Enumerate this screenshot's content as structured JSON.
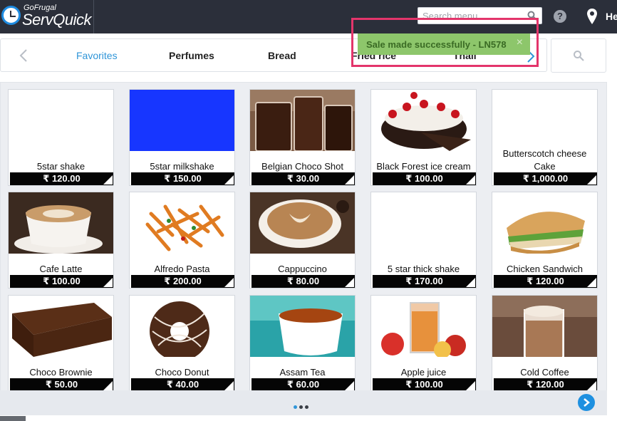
{
  "app": {
    "brand_small": "GoFrugal",
    "brand_big": "ServQuick",
    "search_placeholder": "Search menu",
    "user_text": "He"
  },
  "toast": {
    "message": "Sale made successfully - LN578",
    "close": "×"
  },
  "tabs": [
    {
      "label": "Favorites",
      "active": true
    },
    {
      "label": "Perfumes"
    },
    {
      "label": "Bread"
    },
    {
      "label": "Fried rice"
    },
    {
      "label": "Thali"
    }
  ],
  "products": [
    {
      "name": "5star shake",
      "price": "₹ 120.00",
      "image": "blank"
    },
    {
      "name": "5star milkshake",
      "price": "₹ 150.00",
      "image": "blue"
    },
    {
      "name": "Belgian Choco Shot",
      "price": "₹ 30.00",
      "image": "choco-shot"
    },
    {
      "name": "Black Forest ice cream",
      "price": "₹ 100.00",
      "image": "black-forest"
    },
    {
      "name": "Butterscotch cheese Cake",
      "price": "₹ 1,000.00",
      "image": "blank"
    },
    {
      "name": "Cafe Latte",
      "price": "₹ 100.00",
      "image": "latte"
    },
    {
      "name": "Alfredo Pasta",
      "price": "₹ 200.00",
      "image": "pasta"
    },
    {
      "name": "Cappuccino",
      "price": "₹ 80.00",
      "image": "cappuccino"
    },
    {
      "name": "5 star thick shake",
      "price": "₹ 170.00",
      "image": "blank"
    },
    {
      "name": "Chicken Sandwich",
      "price": "₹ 120.00",
      "image": "sandwich"
    },
    {
      "name": "Choco Brownie",
      "price": "₹ 50.00",
      "image": "brownie"
    },
    {
      "name": "Choco Donut",
      "price": "₹ 40.00",
      "image": "donut"
    },
    {
      "name": "Assam Tea",
      "price": "₹ 60.00",
      "image": "tea"
    },
    {
      "name": "Apple juice",
      "price": "₹ 100.00",
      "image": "juice"
    },
    {
      "name": "Cold Coffee",
      "price": "₹ 120.00",
      "image": "cold-coffee"
    }
  ],
  "colors": {
    "topbar": "#2b2f3a",
    "accent": "#2f95d8",
    "toast_bg": "#8dc66b",
    "highlight_frame": "#e3356b",
    "price_bar": "#050505"
  },
  "pagination": {
    "pages": 3,
    "current": 1
  }
}
